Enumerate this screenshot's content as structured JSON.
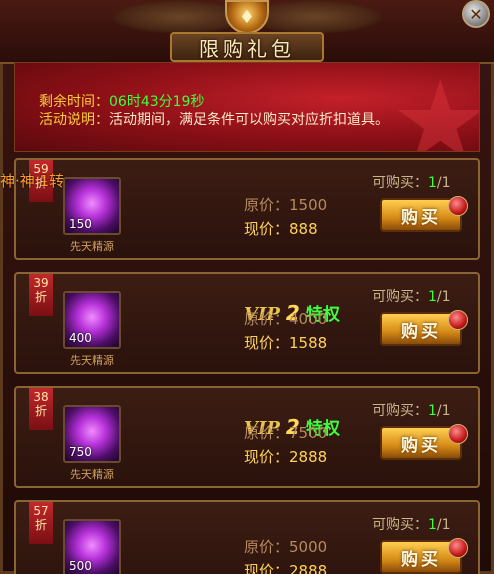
{
  "header": {
    "title": "限购礼包",
    "close_symbol": "✕",
    "emblem_symbol": "♦"
  },
  "banner": {
    "time_label": "剩余时间：",
    "time_value": "06时43分19秒",
    "desc_label": "活动说明：",
    "desc_value": "活动期间，满足条件可以购买对应折扣道具。"
  },
  "overlay_label": "神·神·1转",
  "items": [
    {
      "discount": "59",
      "discount_unit": "折",
      "item_name": "先天精源",
      "qty": "150",
      "vip_word": "",
      "vip_level": "",
      "vip_priv": "",
      "old_price": "原价：1500",
      "new_price": "现价：888",
      "limit_label": "可购买：",
      "limit_current": "1",
      "limit_total": "/1",
      "buy_label": "购买"
    },
    {
      "discount": "39",
      "discount_unit": "折",
      "item_name": "先天精源",
      "qty": "400",
      "vip_word": "VIP",
      "vip_level": "2",
      "vip_priv": "特权",
      "old_price": "原价：4000",
      "new_price": "现价：1588",
      "limit_label": "可购买：",
      "limit_current": "1",
      "limit_total": "/1",
      "buy_label": "购买"
    },
    {
      "discount": "38",
      "discount_unit": "折",
      "item_name": "先天精源",
      "qty": "750",
      "vip_word": "VIP",
      "vip_level": "2",
      "vip_priv": "特权",
      "old_price": "原价：7500",
      "new_price": "现价：2888",
      "limit_label": "可购买：",
      "limit_current": "1",
      "limit_total": "/1",
      "buy_label": "购买"
    },
    {
      "discount": "57",
      "discount_unit": "折",
      "item_name": "先天精源",
      "qty": "500",
      "vip_word": "",
      "vip_level": "",
      "vip_priv": "",
      "old_price": "原价：5000",
      "new_price": "现价：2888",
      "limit_label": "可购买：",
      "limit_current": "1",
      "limit_total": "/1",
      "buy_label": "购买"
    }
  ],
  "colors": {
    "accent_gold": "#ffd35a",
    "highlight_green": "#3dff3d",
    "banner_red": "#8a0f16"
  }
}
